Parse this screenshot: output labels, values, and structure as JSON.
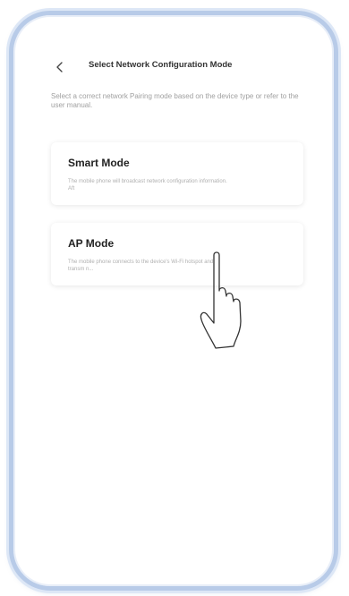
{
  "header": {
    "back_icon": "chevron-left-icon",
    "title": "Select Network Configuration Mode"
  },
  "instructions": "Select a correct network Pairing mode based on the device type or refer to the user manual.",
  "modes": [
    {
      "title": "Smart Mode",
      "description": "The mobile phone will broadcast network configuration information. Aft"
    },
    {
      "title": "AP Mode",
      "description": "The mobile phone connects to the device's Wi-Fi hotspot and transm n..."
    }
  ],
  "overlay": {
    "pointer_icon": "hand-pointer-icon"
  },
  "colors": {
    "frame": "#b8cbe8",
    "title": "#333333",
    "muted": "#a0a0a0"
  }
}
